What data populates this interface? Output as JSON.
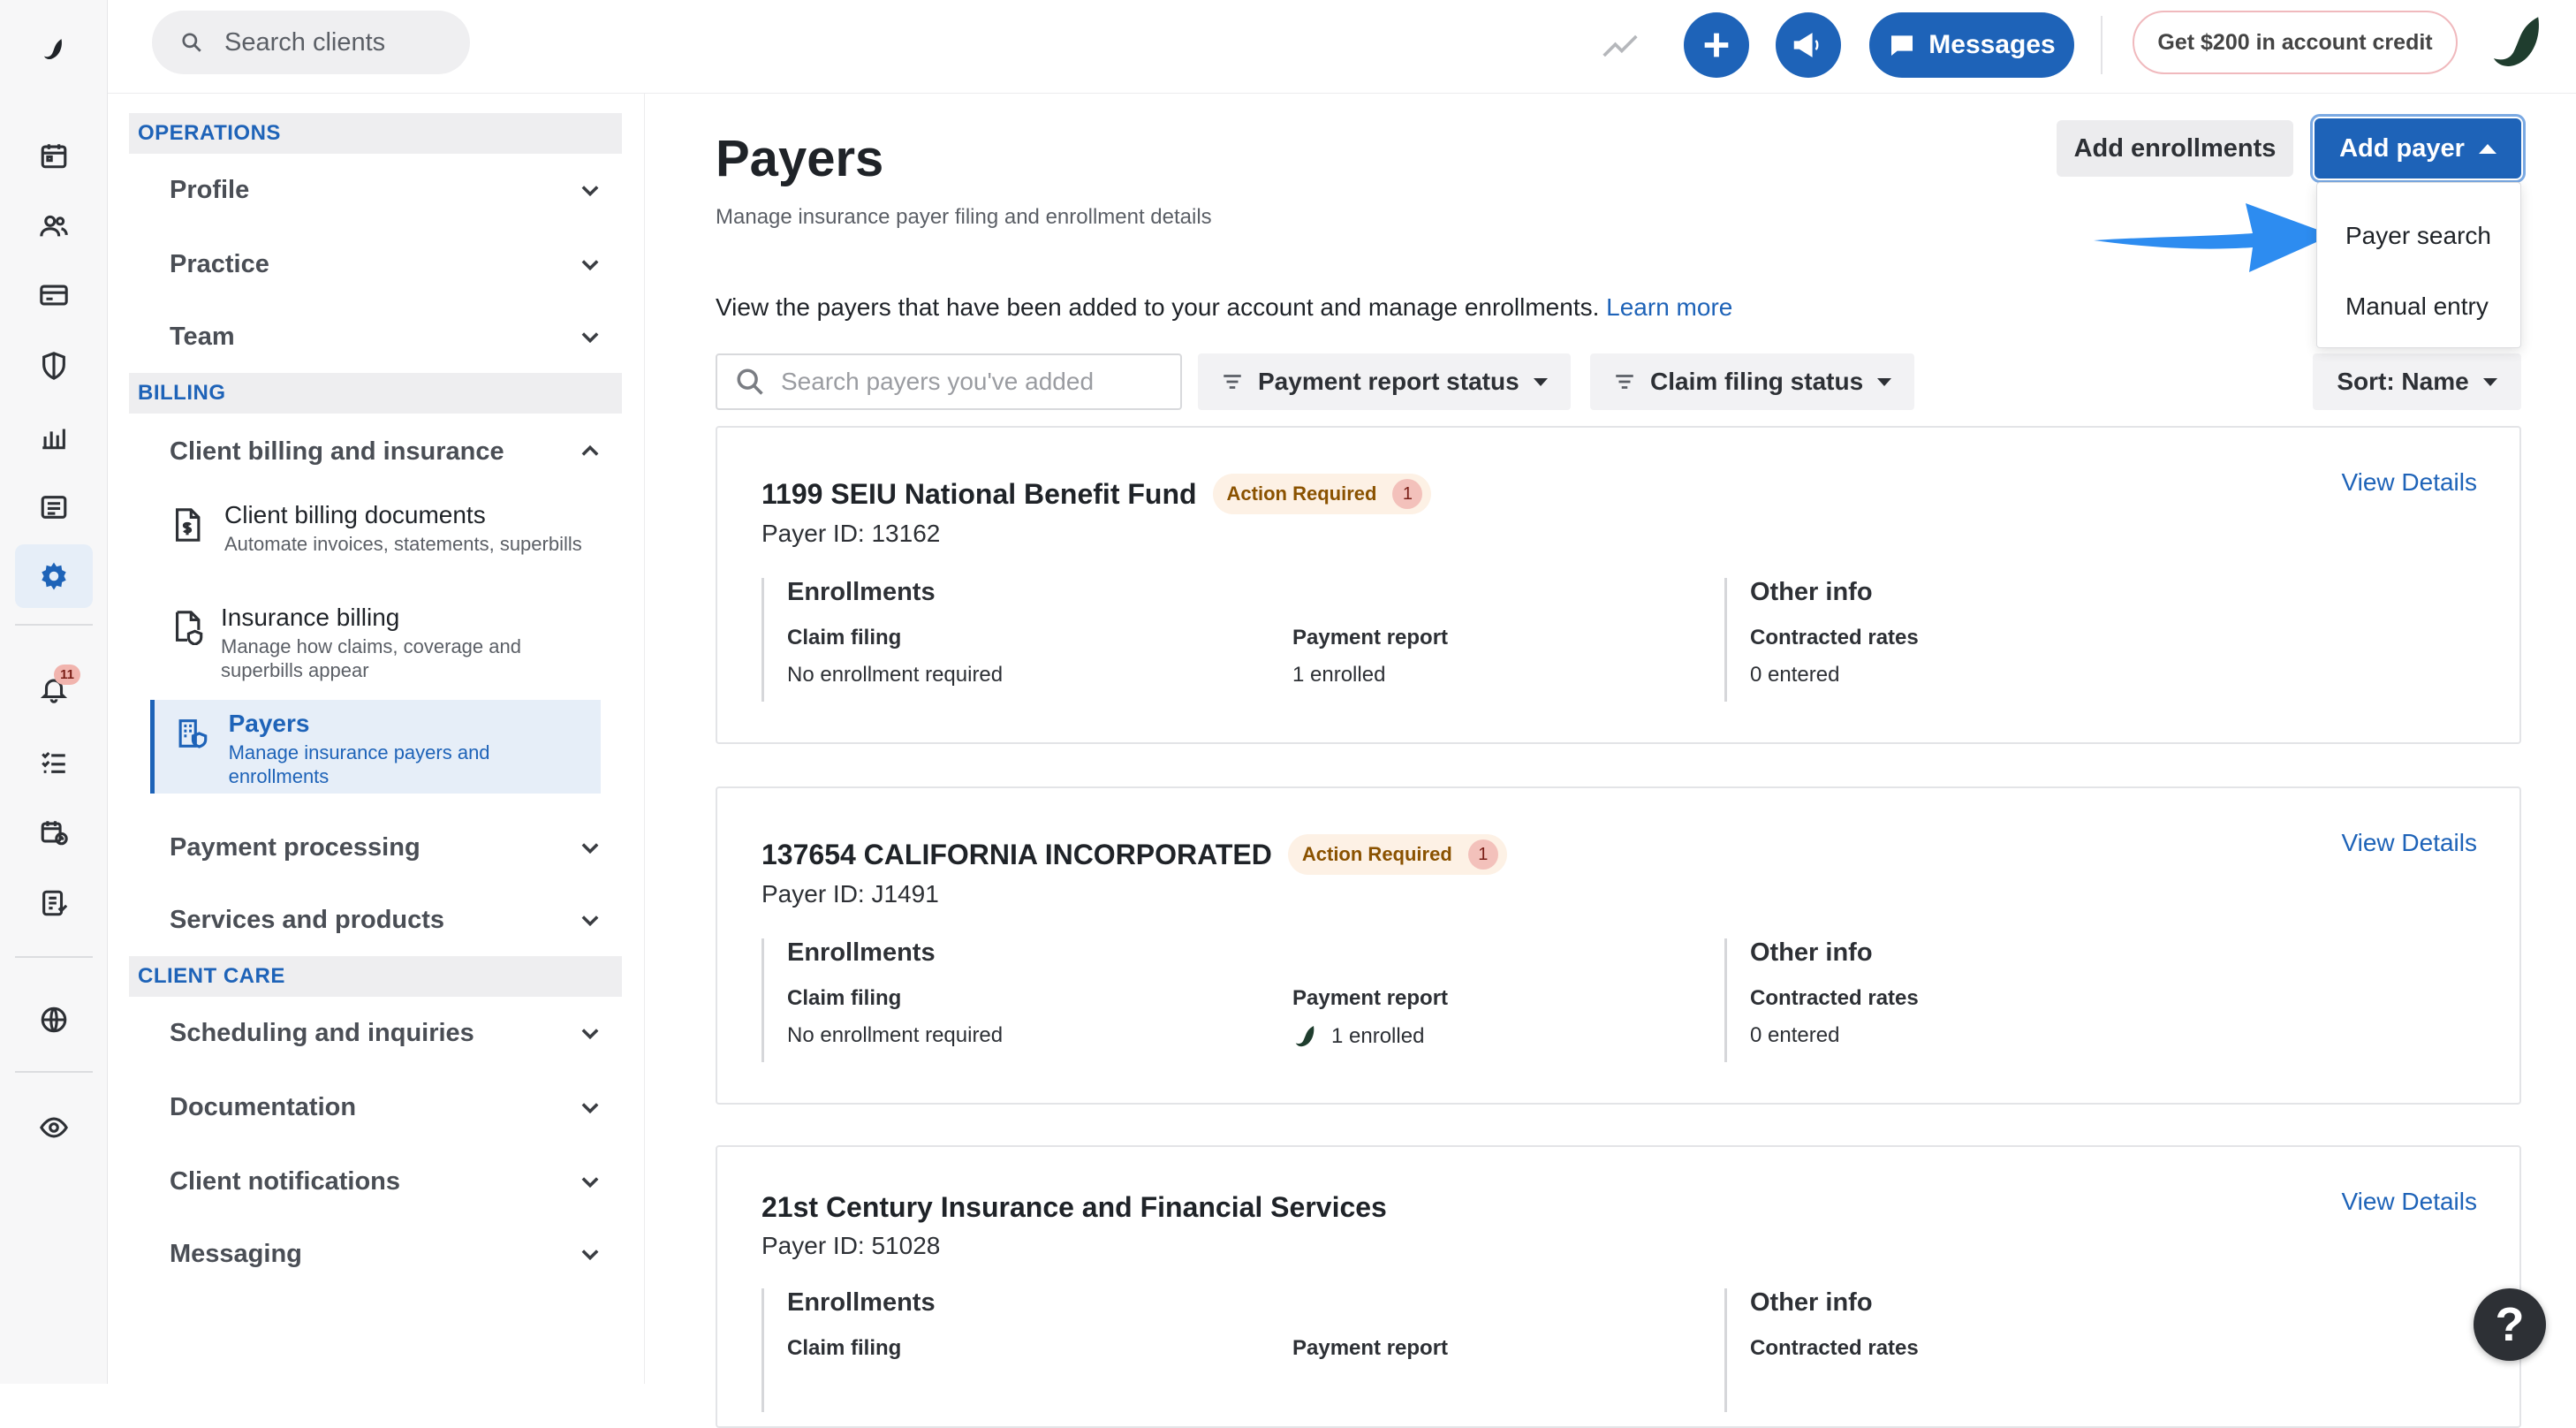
{
  "topbar": {
    "search_placeholder": "Search clients",
    "messages_label": "Messages",
    "credit_label": "Get $200 in account credit"
  },
  "rail": {
    "notification_count": "11"
  },
  "settings_nav": {
    "sections": [
      {
        "header": "OPERATIONS",
        "items": [
          "Profile",
          "Practice",
          "Team"
        ]
      },
      {
        "header": "BILLING",
        "items": [
          "Client billing and insurance",
          "Payment processing",
          "Services and products"
        ]
      },
      {
        "header": "CLIENT CARE",
        "items": [
          "Scheduling and inquiries",
          "Documentation",
          "Client notifications",
          "Messaging"
        ]
      }
    ],
    "billing_subitems": [
      {
        "title": "Client billing documents",
        "desc": "Automate invoices, statements, superbills"
      },
      {
        "title": "Insurance billing",
        "desc": "Manage how claims, coverage and superbills appear"
      },
      {
        "title": "Payers",
        "desc": "Manage insurance payers and enrollments"
      }
    ]
  },
  "main": {
    "title": "Payers",
    "subtitle": "Manage insurance payer filing and enrollment details",
    "add_enrollments_label": "Add enrollments",
    "add_payer_label": "Add payer",
    "dropdown_items": [
      "Payer search",
      "Manual entry"
    ],
    "intro_text": "View the payers that have been added to your account and manage enrollments.",
    "learn_more": "Learn more",
    "search_placeholder": "Search payers you've added",
    "filter_payment": "Payment report status",
    "filter_claim": "Claim filing status",
    "sort_label": "Sort: Name"
  },
  "card_labels": {
    "view_details": "View Details",
    "enrollments": "Enrollments",
    "other_info": "Other info",
    "claim_filing": "Claim filing",
    "payment_report": "Payment report",
    "contracted_rates": "Contracted rates",
    "action_required": "Action Required"
  },
  "payers": [
    {
      "name": "1199 SEIU National Benefit Fund",
      "payer_id": "Payer ID: 13162",
      "badge_count": "1",
      "claim_filing": "No enrollment required",
      "payment_report": "1 enrolled",
      "contracted_rates": "0 entered"
    },
    {
      "name": "137654 CALIFORNIA INCORPORATED",
      "payer_id": "Payer ID: J1491",
      "badge_count": "1",
      "claim_filing": "No enrollment required",
      "payment_report": "1 enrolled",
      "contracted_rates": "0 entered"
    },
    {
      "name": "21st Century Insurance and Financial Services",
      "payer_id": "Payer ID: 51028"
    }
  ],
  "help_label": "?",
  "colors": {
    "accent": "#1e63b8",
    "badge_bg": "#fdf1e5",
    "badge_text": "#8a5200"
  }
}
